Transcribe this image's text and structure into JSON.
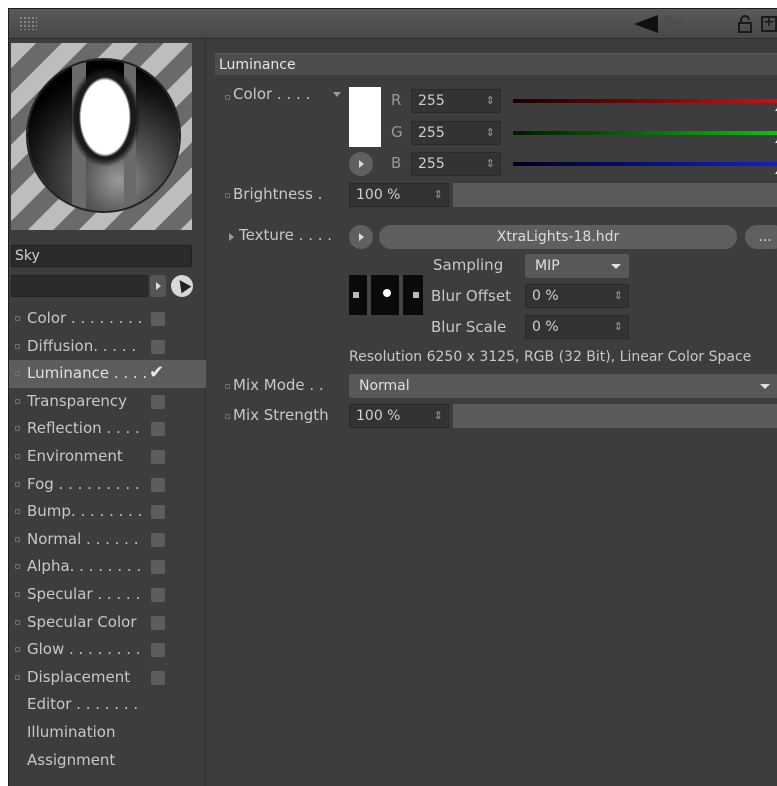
{
  "top_bar": {
    "icons": [
      "grip-icon",
      "back-arrow-icon",
      "forward-arrow-icon",
      "lock-icon",
      "new-window-icon"
    ]
  },
  "material": {
    "name": "Sky",
    "filter_value": ""
  },
  "channels": [
    {
      "label": "Color . . . . . . . .",
      "checked": false,
      "active": false
    },
    {
      "label": "Diffusion. . . . .",
      "checked": false,
      "active": false
    },
    {
      "label": "Luminance . . . .",
      "checked": true,
      "active": true
    },
    {
      "label": "Transparency",
      "checked": false,
      "active": false
    },
    {
      "label": "Reflection . . . .",
      "checked": false,
      "active": false
    },
    {
      "label": "Environment",
      "checked": false,
      "active": false
    },
    {
      "label": "Fog . . . . . . . . .",
      "checked": false,
      "active": false
    },
    {
      "label": "Bump. . . . . . . .",
      "checked": false,
      "active": false
    },
    {
      "label": "Normal . . . . . .",
      "checked": false,
      "active": false
    },
    {
      "label": "Alpha. . . . . . . .",
      "checked": false,
      "active": false
    },
    {
      "label": "Specular . . . . .",
      "checked": false,
      "active": false
    },
    {
      "label": "Specular Color",
      "checked": false,
      "active": false
    },
    {
      "label": "Glow . . . . . . . .",
      "checked": false,
      "active": false
    },
    {
      "label": "Displacement",
      "checked": false,
      "active": false
    }
  ],
  "extra_items": [
    "Editor . . . . . . .",
    "Illumination",
    "Assignment"
  ],
  "section": {
    "title": "Luminance",
    "color_label": "Color . . . .",
    "color_hex": "#ffffff",
    "r_label": "R",
    "r_value": "255",
    "g_label": "G",
    "g_value": "255",
    "b_label": "B",
    "b_value": "255",
    "brightness_label": "Brightness .",
    "brightness_value": "100 %",
    "texture_label": "Texture . . . .",
    "texture_file": "XtraLights-18.hdr",
    "browse_label": "...",
    "sampling_label": "Sampling",
    "sampling_value": "MIP",
    "blur_offset_label": "Blur Offset",
    "blur_offset_value": "0 %",
    "blur_scale_label": "Blur Scale",
    "blur_scale_value": "0 %",
    "resolution_text": "Resolution 6250 x 3125, RGB (32 Bit), Linear Color Space",
    "mix_mode_label": "Mix Mode . .",
    "mix_mode_value": "Normal",
    "mix_strength_label": "Mix Strength",
    "mix_strength_value": "100 %"
  },
  "colors": {
    "red_channel": "#d01010",
    "green_channel": "#10c010",
    "blue_channel": "#1020d0",
    "panel_bg": "#3d3d3d"
  }
}
